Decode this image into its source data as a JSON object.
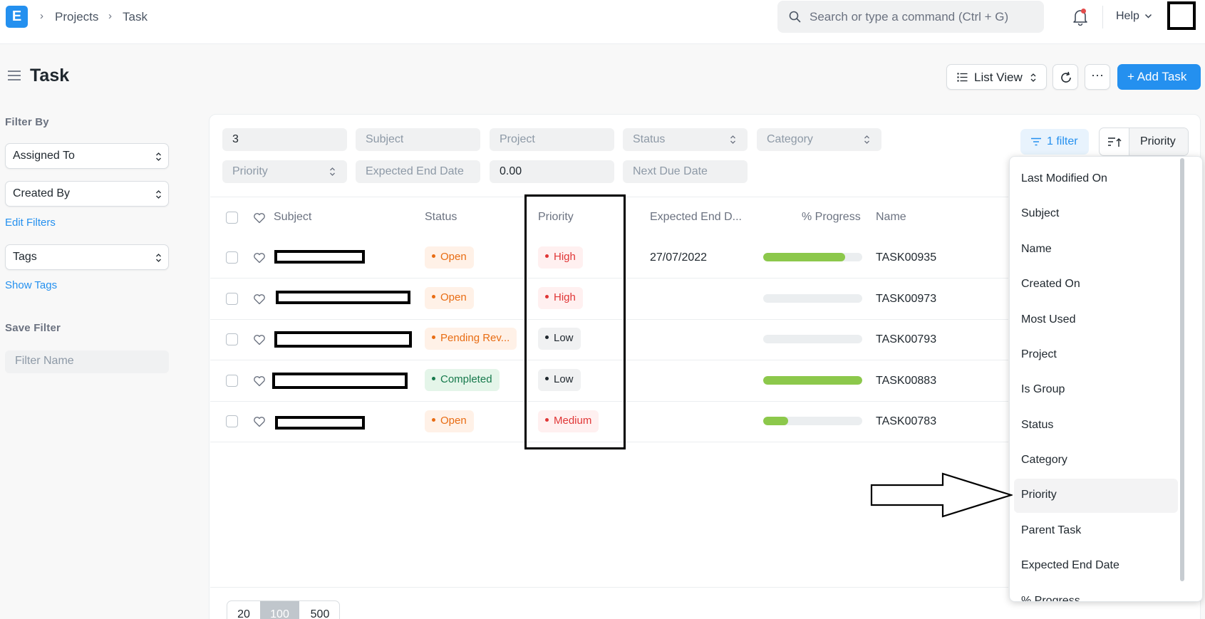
{
  "navbar": {
    "logo_letter": "E",
    "breadcrumbs": [
      "Projects",
      "Task"
    ],
    "search_placeholder": "Search or type a command (Ctrl + G)",
    "help_label": "Help"
  },
  "page": {
    "title": "Task",
    "list_view_label": "List View",
    "more_label": "···",
    "add_label": "+ Add Task"
  },
  "sidebar": {
    "filter_by_heading": "Filter By",
    "assigned_to": "Assigned To",
    "created_by": "Created By",
    "edit_filters": "Edit Filters",
    "tags": "Tags",
    "show_tags": "Show Tags",
    "save_filter_heading": "Save Filter",
    "filter_name_placeholder": "Filter Name"
  },
  "filters": {
    "id_value": "3",
    "subject": "Subject",
    "project": "Project",
    "status": "Status",
    "category": "Category",
    "priority": "Priority",
    "expected_end_date": "Expected End Date",
    "progress_value": "0.00",
    "next_due_date": "Next Due Date",
    "filter_button": "1 filter",
    "sort_label": "Priority"
  },
  "table": {
    "columns": {
      "subject": "Subject",
      "status": "Status",
      "priority": "Priority",
      "expected_end": "Expected End D...",
      "progress": "% Progress",
      "name": "Name"
    },
    "rows": [
      {
        "status": "Open",
        "priority": "High",
        "expected_end": "27/07/2022",
        "progress": 0.83,
        "name": "TASK00935"
      },
      {
        "status": "Open",
        "priority": "High",
        "expected_end": "",
        "progress": 0,
        "name": "TASK00973"
      },
      {
        "status": "Pending Rev...",
        "priority": "Low",
        "expected_end": "",
        "progress": 0,
        "name": "TASK00793"
      },
      {
        "status": "Completed",
        "priority": "Low",
        "expected_end": "",
        "progress": 1.0,
        "name": "TASK00883"
      },
      {
        "status": "Open",
        "priority": "Medium",
        "expected_end": "",
        "progress": 0.25,
        "name": "TASK00783"
      }
    ]
  },
  "paging": {
    "options": [
      "20",
      "100",
      "500"
    ],
    "selected": "100"
  },
  "sort_dropdown": {
    "items": [
      "Last Modified On",
      "Subject",
      "Name",
      "Created On",
      "Most Used",
      "Project",
      "Is Group",
      "Status",
      "Category",
      "Priority",
      "Parent Task",
      "Expected End Date",
      "% Progress"
    ],
    "highlighted": "Priority"
  },
  "colors": {
    "accent": "#2490ef",
    "progress": "#8cc84b"
  }
}
